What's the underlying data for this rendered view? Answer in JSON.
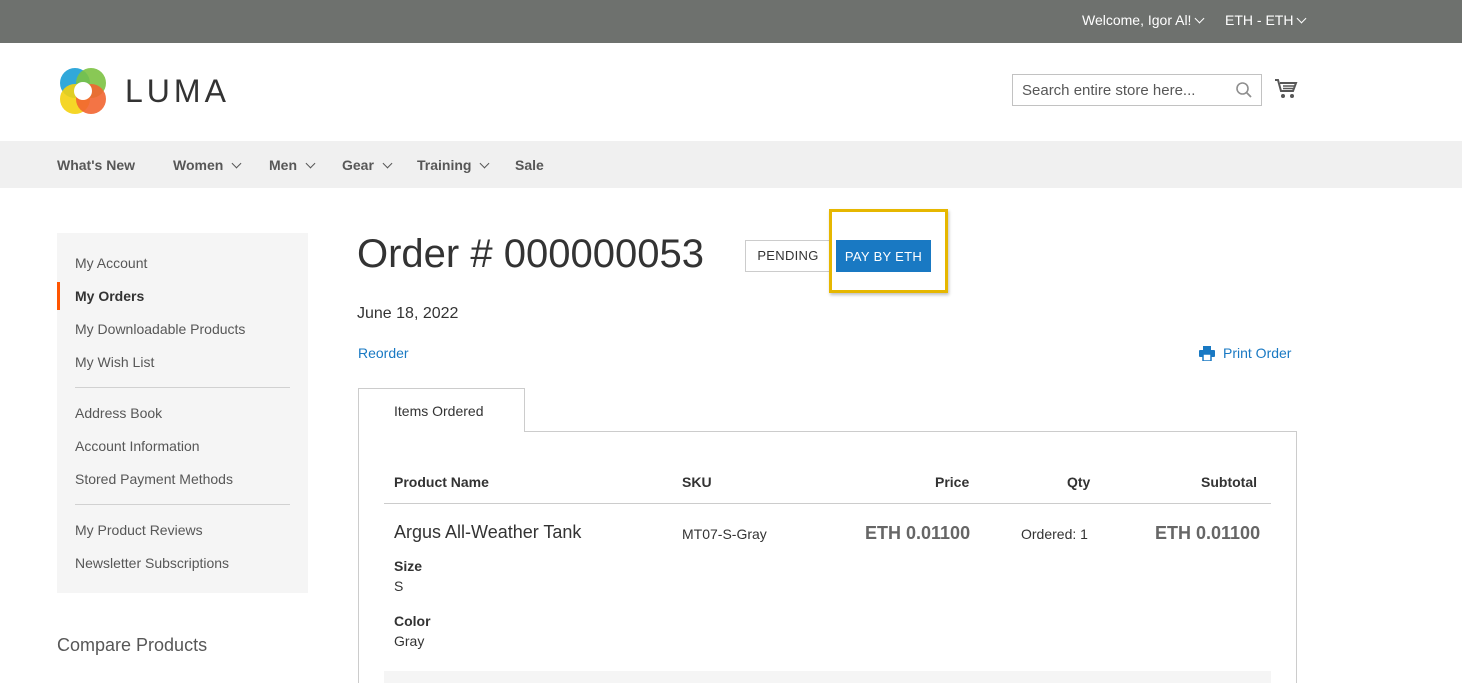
{
  "topbar": {
    "welcome": "Welcome, Igor Al!",
    "currency": "ETH - ETH"
  },
  "header": {
    "logo_text": "LUMA",
    "search_placeholder": "Search entire store here..."
  },
  "nav": {
    "items": [
      "What's New",
      "Women",
      "Men",
      "Gear",
      "Training",
      "Sale"
    ]
  },
  "sidebar": {
    "items": [
      "My Account",
      "My Orders",
      "My Downloadable Products",
      "My Wish List",
      "Address Book",
      "Account Information",
      "Stored Payment Methods",
      "My Product Reviews",
      "Newsletter Subscriptions"
    ],
    "active_index": 1,
    "compare_title": "Compare Products"
  },
  "order": {
    "title": "Order # 000000053",
    "status": "PENDING",
    "pay_button": "PAY BY ETH",
    "date": "June 18, 2022",
    "reorder": "Reorder",
    "print": "Print Order"
  },
  "tabs": {
    "items_ordered": "Items Ordered"
  },
  "table": {
    "headers": {
      "product_name": "Product Name",
      "sku": "SKU",
      "price": "Price",
      "qty": "Qty",
      "subtotal": "Subtotal"
    },
    "rows": [
      {
        "name": "Argus All-Weather Tank",
        "sku": "MT07-S-Gray",
        "price": "ETH 0.01100",
        "qty": "Ordered: 1",
        "subtotal": "ETH 0.01100",
        "options": [
          {
            "label": "Size",
            "value": "S"
          },
          {
            "label": "Color",
            "value": "Gray"
          }
        ]
      }
    ]
  },
  "colors": {
    "topbar": "#6e716e",
    "link": "#1979c3",
    "accent": "#ff5501",
    "highlight": "#e6b700"
  }
}
